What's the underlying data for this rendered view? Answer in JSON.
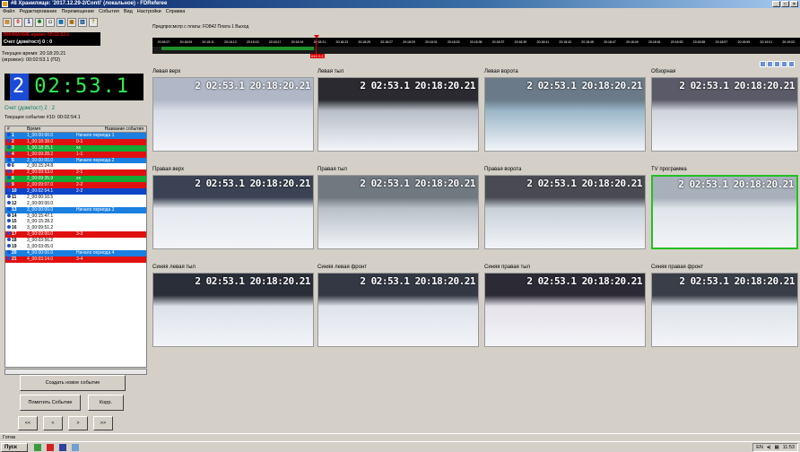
{
  "window": {
    "title": "#8 Хранилище: '2017.12.29-2/Conti' (локальное) - FDReferee"
  },
  "menu": [
    "Файл",
    "Редактирование",
    "Перемещение",
    "События",
    "Вид",
    "Настройки",
    "Справка"
  ],
  "left": {
    "replay_banner": "ВНИМАНИЕ время: 00:02:53.1",
    "score_top": "Счет (дом/гост)   0 : 0",
    "current_time_label": "Текущее время: 20:18:20.21",
    "game_time_label": "(игровое): 00:02:53.1 (П2)",
    "clock_period": "2",
    "clock_time": "02:53.1",
    "score_line": "Счет (дом/гост)   2 : 2",
    "current_event": "Текущее событие #10: 00:02:54.1",
    "list_header": {
      "num": "#",
      "time": "Время",
      "name": "Название события"
    },
    "events": [
      {
        "n": "1",
        "time": "1_00:00:00.0",
        "desc": "Начало периода 1",
        "style": "sel"
      },
      {
        "n": "2",
        "time": "1_00:18:38.0",
        "desc": "0-1",
        "style": "red"
      },
      {
        "n": "3",
        "time": "1_00:18:25.1",
        "desc": "xx",
        "style": "green"
      },
      {
        "n": "4",
        "time": "1_00:09:28.2",
        "desc": "1-1",
        "style": "red"
      },
      {
        "n": "5",
        "time": "2_00:00:00.0",
        "desc": "Начало периода 2",
        "style": "sel"
      },
      {
        "n": "6",
        "time": "2_00:15:24.8",
        "desc": "",
        "style": ""
      },
      {
        "n": "7",
        "time": "2_00:09:53.0",
        "desc": "2-1",
        "style": "red"
      },
      {
        "n": "8",
        "time": "2_00:09:35.9",
        "desc": "xx",
        "style": "green"
      },
      {
        "n": "9",
        "time": "2_00:09:07.0",
        "desc": "2-2",
        "style": "red"
      },
      {
        "n": "10",
        "time": "2_00:02:54.1",
        "desc": "2-2",
        "style": "blue"
      },
      {
        "n": "11",
        "time": "2_00:00:10.5",
        "desc": "",
        "style": ""
      },
      {
        "n": "12",
        "time": "2_00:00:00.0",
        "desc": "",
        "style": ""
      },
      {
        "n": "13",
        "time": "3_00:00:00.0",
        "desc": "Начало периода 3",
        "style": "sel"
      },
      {
        "n": "14",
        "time": "3_00:15:47.1",
        "desc": "",
        "style": ""
      },
      {
        "n": "15",
        "time": "3_00:15:28.2",
        "desc": "",
        "style": ""
      },
      {
        "n": "16",
        "time": "3_00:09:51.2",
        "desc": "",
        "style": ""
      },
      {
        "n": "17",
        "time": "3_00:09:00.0",
        "desc": "3-3",
        "style": "red"
      },
      {
        "n": "18",
        "time": "3_00:03:56.2",
        "desc": "",
        "style": ""
      },
      {
        "n": "19",
        "time": "3_00:03:05.0",
        "desc": "",
        "style": ""
      },
      {
        "n": "20",
        "time": "4_00:00:00.0",
        "desc": "Начало периода 4",
        "style": "sel"
      },
      {
        "n": "21",
        "time": "4_00:03:14.0",
        "desc": "3-4",
        "style": "red"
      }
    ],
    "btn_new_event": "Создать новое событие",
    "btn_mark": "Пометить Событие",
    "btn_corr": "Корр.",
    "nav": [
      "<<",
      "<",
      ">",
      ">>"
    ]
  },
  "center_top": "Предпросмотр с платы: FD842 Плата 1 Выход",
  "timeline": {
    "ticks": [
      "20:18:07",
      "20:18:09",
      "20:18:11",
      "20:18:13",
      "20:18:15",
      "20:18:17",
      "20:18:19",
      "20:18:21",
      "20:18:23",
      "20:18:25",
      "20:18:27",
      "20:18:29",
      "20:18:31",
      "20:18:33",
      "20:18:35",
      "20:18:37",
      "20:18:39",
      "20:18:41",
      "20:18:43",
      "20:18:45",
      "20:18:47",
      "20:18:49",
      "20:18:51",
      "20:18:53",
      "20:18:55",
      "20:18:57",
      "20:18:59",
      "20:19:01",
      "20:19:03"
    ],
    "marker_label": "#10 2-2"
  },
  "timestamp_overlay": "2 02:53.1 20:18:20.21",
  "cameras": [
    {
      "label": "Левая верх"
    },
    {
      "label": "Левая тыл"
    },
    {
      "label": "Левая ворота"
    },
    {
      "label": "Обзорная"
    },
    {
      "label": "Правая верх"
    },
    {
      "label": "Правая тыл"
    },
    {
      "label": "Правая ворота"
    },
    {
      "label": "TV программа"
    },
    {
      "label": "Синяя левая тыл"
    },
    {
      "label": "Синяя левая фронт"
    },
    {
      "label": "Синяя правая тыл"
    },
    {
      "label": "Синяя правая фронт"
    }
  ],
  "statusbar": "Готов",
  "taskbar": {
    "start": "Пуск",
    "lang": "EN",
    "clock": "11:53"
  }
}
